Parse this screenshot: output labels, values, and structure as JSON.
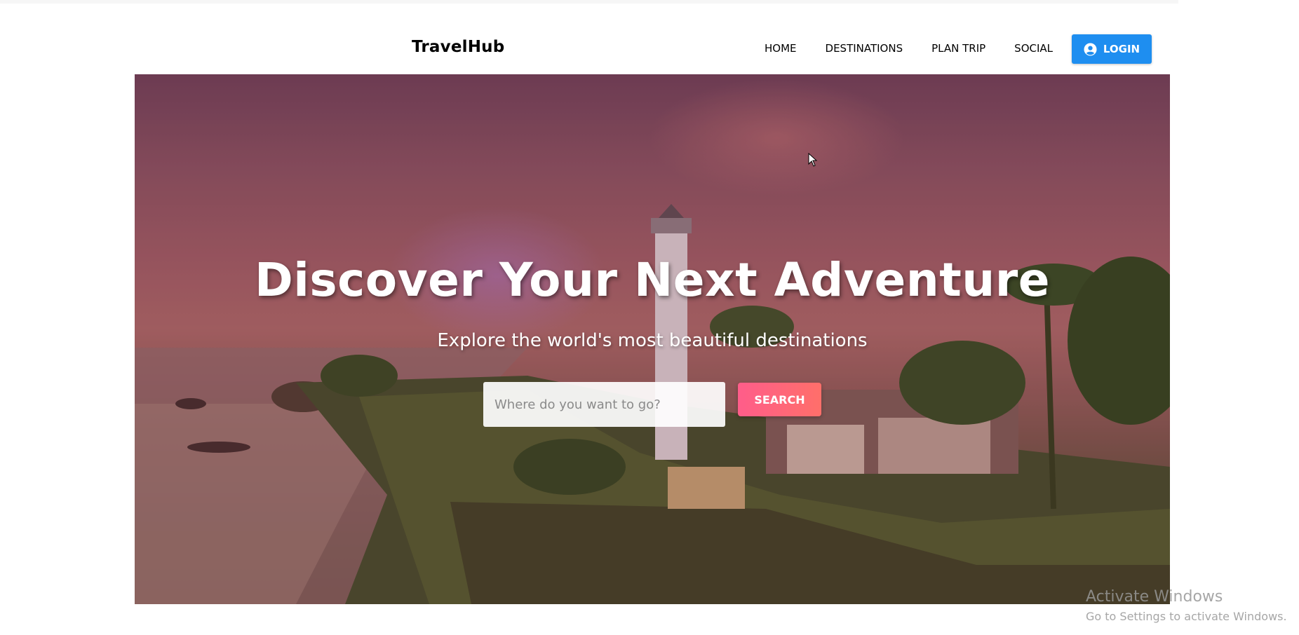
{
  "header": {
    "logo": "TravelHub",
    "nav": [
      {
        "label": "HOME"
      },
      {
        "label": "DESTINATIONS"
      },
      {
        "label": "PLAN TRIP"
      },
      {
        "label": "SOCIAL"
      }
    ],
    "login_label": "LOGIN",
    "login_icon": "user-circle-icon",
    "accent_color": "#1e8ef0"
  },
  "hero": {
    "title": "Discover Your Next Adventure",
    "subtitle": "Explore the world's most beautiful destinations",
    "search_placeholder": "Where do you want to go?",
    "search_value": "",
    "search_button": "SEARCH",
    "search_button_color": "#ff637a"
  },
  "watermark": {
    "title": "Activate Windows",
    "subtitle": "Go to Settings to activate Windows."
  }
}
